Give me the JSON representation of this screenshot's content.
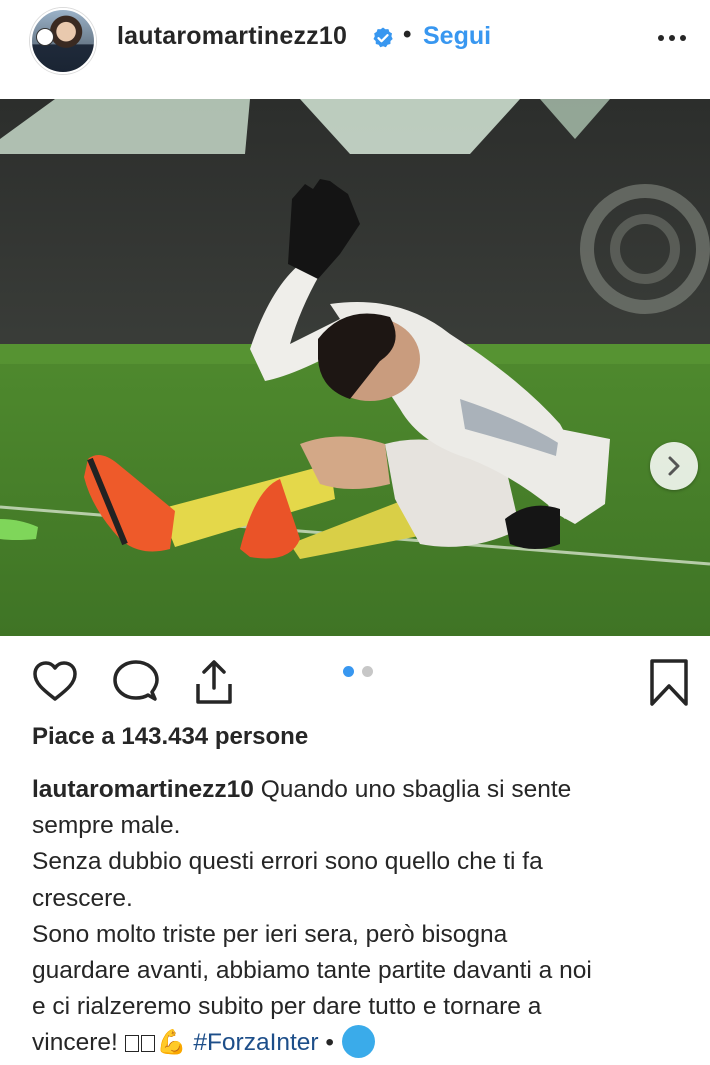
{
  "header": {
    "username": "lautaromartinezz10",
    "separator": "•",
    "follow_label": "Segui"
  },
  "post": {
    "likes_text": "Piace a 143.434 persone",
    "carousel": {
      "total": 2,
      "current": 1
    },
    "caption": {
      "username": "lautaromartinezz10",
      "line1_rest": " Quando uno sbaglia si sente",
      "line2": "sempre male.",
      "line3": "Senza dubbio questi errori sono quello che ti fa",
      "line4": "crescere.",
      "line5": "Sono molto triste per ieri sera, però bisogna",
      "line6": "guardare avanti, abbiamo tante partite davanti a noi",
      "line7": "e ci rialzeremo subito per dare tutto e tornare a",
      "line8_start": "vincere!",
      "emoji": "💪",
      "hashtag": "#ForzaInter",
      "dot": "•"
    }
  },
  "colors": {
    "link_blue": "#3897f0",
    "text": "#262626",
    "verified_blue": "#3897f0",
    "pager_active": "#3897f0",
    "pager_inactive": "#c7c7c7"
  },
  "icons": {
    "verified": "verified-badge-icon",
    "more": "more-options-icon",
    "like": "heart-icon",
    "comment": "comment-icon",
    "share": "share-icon",
    "save": "bookmark-icon",
    "next": "chevron-right-icon"
  }
}
